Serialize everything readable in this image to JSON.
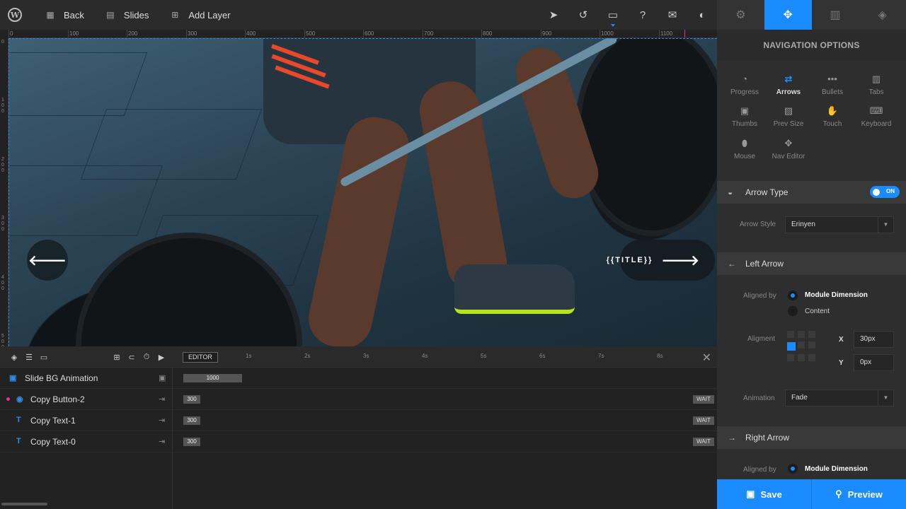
{
  "toolbar": {
    "back_label": "Back",
    "slides_label": "Slides",
    "add_layer_label": "Add Layer"
  },
  "ruler": {
    "marks": [
      "0",
      "100",
      "200",
      "300",
      "400",
      "500",
      "600",
      "700",
      "800",
      "900",
      "1000",
      "1100"
    ],
    "vertical": [
      "0",
      "100",
      "200",
      "300",
      "400",
      "500"
    ]
  },
  "canvas": {
    "right_arrow_title": "{{TITLE}}"
  },
  "timeline": {
    "editor_label": "EDITOR",
    "seconds": [
      "1s",
      "2s",
      "3s",
      "4s",
      "5s",
      "6s",
      "7s",
      "8s"
    ],
    "rows": [
      {
        "name": "Slide BG Animation",
        "duration": "1000"
      },
      {
        "name": "Copy Button-2",
        "duration": "300",
        "wait": "WAIT"
      },
      {
        "name": "Copy Text-1",
        "duration": "300",
        "wait": "WAIT"
      },
      {
        "name": "Copy Text-0",
        "duration": "300",
        "wait": "WAIT"
      }
    ]
  },
  "panel": {
    "title": "NAVIGATION OPTIONS",
    "nav_items": [
      "Progress",
      "Arrows",
      "Bullets",
      "Tabs",
      "Thumbs",
      "Prev Size",
      "Touch",
      "Keyboard",
      "Mouse",
      "Nav Editor"
    ],
    "arrow_type": {
      "title": "Arrow Type",
      "toggle": "ON"
    },
    "arrow_style": {
      "label": "Arrow Style",
      "value": "Erinyen"
    },
    "left_arrow": {
      "title": "Left Arrow",
      "aligned_by_label": "Aligned by",
      "option_module": "Module Dimension",
      "option_content": "Content",
      "alignment_label": "Aligment",
      "x_label": "X",
      "x_value": "30px",
      "y_label": "Y",
      "y_value": "0px",
      "animation_label": "Animation",
      "animation_value": "Fade"
    },
    "right_arrow": {
      "title": "Right Arrow",
      "aligned_by_label": "Aligned by",
      "option_module": "Module Dimension"
    },
    "save_label": "Save",
    "preview_label": "Preview"
  },
  "colors": {
    "accent": "#1a8cff",
    "marker": "#e8328b"
  }
}
